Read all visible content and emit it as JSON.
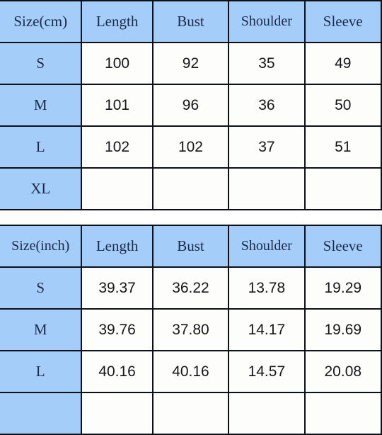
{
  "tables": [
    {
      "id": "cm",
      "headers": [
        "Size(cm)",
        "Length",
        "Bust",
        "Shoulder",
        "Sleeve"
      ],
      "rows": [
        {
          "size": "S",
          "values": [
            "100",
            "92",
            "35",
            "49"
          ]
        },
        {
          "size": "M",
          "values": [
            "101",
            "96",
            "36",
            "50"
          ]
        },
        {
          "size": "L",
          "values": [
            "102",
            "102",
            "37",
            "51"
          ]
        },
        {
          "size": "XL",
          "values": [
            "",
            "",
            "",
            ""
          ]
        }
      ]
    },
    {
      "id": "inch",
      "headers": [
        "Size(inch)",
        "Length",
        "Bust",
        "Shoulder",
        "Sleeve"
      ],
      "rows": [
        {
          "size": "S",
          "values": [
            "39.37",
            "36.22",
            "13.78",
            "19.29"
          ]
        },
        {
          "size": "M",
          "values": [
            "39.76",
            "37.80",
            "14.17",
            "19.69"
          ]
        },
        {
          "size": "L",
          "values": [
            "40.16",
            "40.16",
            "14.57",
            "20.08"
          ]
        },
        {
          "size": "",
          "values": [
            "",
            "",
            "",
            ""
          ]
        }
      ]
    }
  ],
  "colors": {
    "header_blue": "#a5cdfa",
    "cell_white": "#fdfdfb",
    "border": "#0d1017",
    "header_text": "#1b2a4a",
    "value_text": "#15161a"
  }
}
